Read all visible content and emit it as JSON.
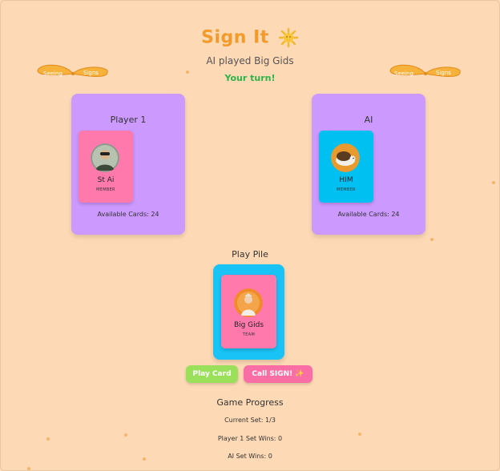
{
  "header": {
    "title": "Sign It",
    "subtitle": "AI played Big Gids",
    "turn_status": "Your turn!"
  },
  "decor": {
    "left_wings_text": [
      "Seeing",
      "Signs"
    ],
    "right_wings_text": [
      "Seeing",
      "Signs"
    ]
  },
  "players": [
    {
      "label": "Player 1",
      "card": {
        "name": "St Ai",
        "role": "MEMBER",
        "color": "#ff79ac"
      },
      "available_cards": "Available Cards: 24"
    },
    {
      "label": "AI",
      "card": {
        "name": "HIM",
        "role": "MEMBER",
        "color": "#00c0f2"
      },
      "available_cards": "Available Cards: 24"
    }
  ],
  "play_pile": {
    "label": "Play Pile",
    "card": {
      "name": "Big Gids",
      "role": "TEAM",
      "color": "#ff79ac"
    }
  },
  "actions": {
    "play_card": "Play Card",
    "call_sign": "Call SIGN! ✨"
  },
  "progress": {
    "title": "Game Progress",
    "current_set": "Current Set: 1/3",
    "player1_wins": "Player 1 Set Wins: 0",
    "ai_wins": "AI Set Wins: 0"
  },
  "colors": {
    "background": "#fdd9b5",
    "accent_orange": "#f39a2a",
    "turn_green": "#2cb34a",
    "panel_purple": "#cc99ff",
    "play_button": "#9ae05b",
    "sign_button": "#fa6ea6"
  }
}
